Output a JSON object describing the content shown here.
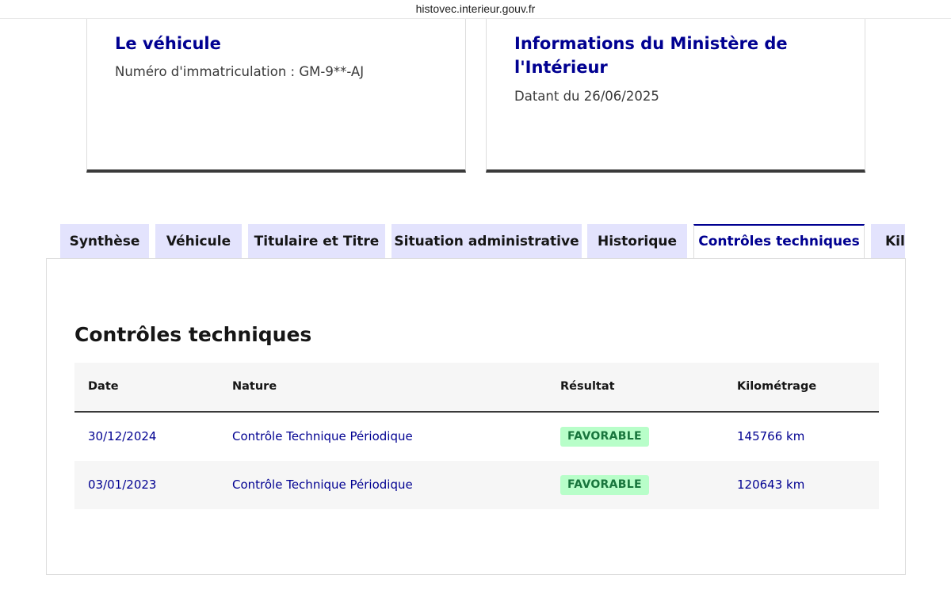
{
  "browser": {
    "url": "histovec.interieur.gouv.fr"
  },
  "cards": {
    "vehicle": {
      "title": "Le véhicule",
      "subtitle": "Numéro d'immatriculation : GM-9**-AJ"
    },
    "ministry": {
      "title": "Informations du Ministère de l'Intérieur",
      "subtitle": "Datant du 26/06/2025"
    }
  },
  "tabs": [
    {
      "label": "Synthèse"
    },
    {
      "label": "Véhicule"
    },
    {
      "label": "Titulaire et Titre"
    },
    {
      "label": "Situation administrative"
    },
    {
      "label": "Historique"
    },
    {
      "label": "Contrôles techniques",
      "active": true
    },
    {
      "label": "Kilométrage"
    }
  ],
  "panel": {
    "title": "Contrôles techniques",
    "table": {
      "headers": [
        "Date",
        "Nature",
        "Résultat",
        "Kilométrage"
      ],
      "rows": [
        {
          "date": "30/12/2024",
          "nature": "Contrôle Technique Périodique",
          "result": "FAVORABLE",
          "mileage": "145766 km"
        },
        {
          "date": "03/01/2023",
          "nature": "Contrôle Technique Périodique",
          "result": "FAVORABLE",
          "mileage": "120643 km"
        }
      ]
    }
  },
  "colors": {
    "brand_blue": "#000091",
    "tab_bg": "#e3e3fd",
    "badge_bg": "#b8fec9",
    "badge_text": "#18753c"
  }
}
